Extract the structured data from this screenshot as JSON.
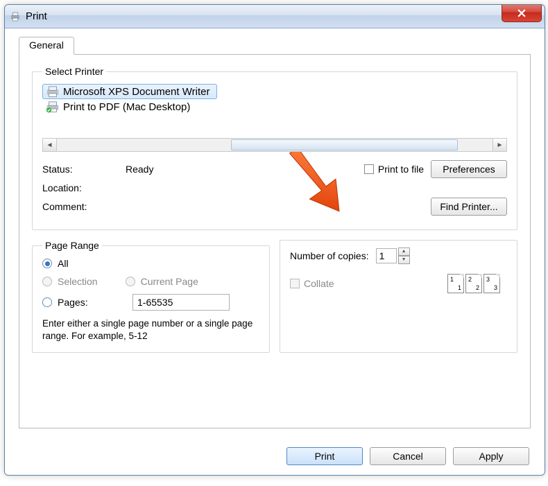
{
  "window": {
    "title": "Print"
  },
  "tabs": {
    "general": "General"
  },
  "printer_group": {
    "legend": "Select Printer",
    "printers": [
      {
        "name": "Microsoft XPS Document Writer"
      },
      {
        "name": "Print to PDF (Mac Desktop)"
      }
    ],
    "status_label": "Status:",
    "status_value": "Ready",
    "location_label": "Location:",
    "comment_label": "Comment:",
    "print_to_file": "Print to file",
    "preferences": "Preferences",
    "find_printer": "Find Printer..."
  },
  "page_range": {
    "legend": "Page Range",
    "all": "All",
    "selection": "Selection",
    "current_page": "Current Page",
    "pages": "Pages:",
    "pages_value": "1-65535",
    "hint": "Enter either a single page number or a single page range.  For example, 5-12"
  },
  "copies": {
    "number_label": "Number of copies:",
    "number_value": "1",
    "collate": "Collate"
  },
  "buttons": {
    "print": "Print",
    "cancel": "Cancel",
    "apply": "Apply"
  }
}
